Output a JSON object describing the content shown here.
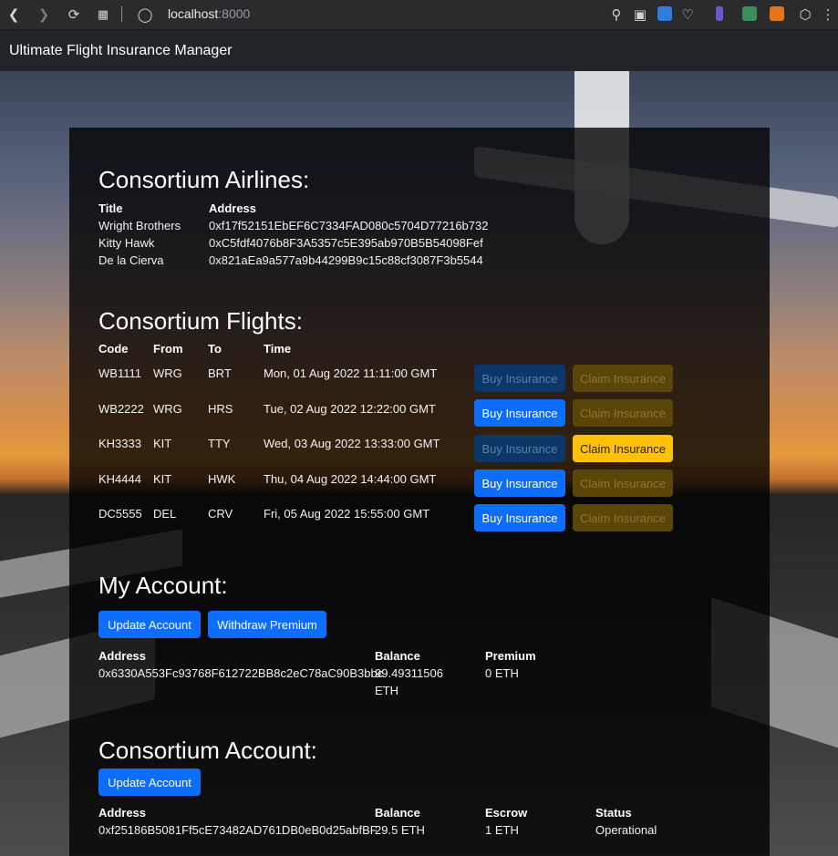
{
  "browser": {
    "url_host": "localhost",
    "url_port": ":8000"
  },
  "navbar": {
    "brand": "Ultimate Flight Insurance Manager"
  },
  "airlines": {
    "heading": "Consortium Airlines:",
    "headers": {
      "title": "Title",
      "address": "Address"
    },
    "rows": [
      {
        "title": "Wright Brothers",
        "address": "0xf17f52151EbEF6C7334FAD080c5704D77216b732"
      },
      {
        "title": "Kitty Hawk",
        "address": "0xC5fdf4076b8F3A5357c5E395ab970B5B54098Fef"
      },
      {
        "title": "De la Cierva",
        "address": "0x821aEa9a577a9b44299B9c15c88cf3087F3b5544"
      }
    ]
  },
  "flights": {
    "heading": "Consortium Flights:",
    "headers": {
      "code": "Code",
      "from": "From",
      "to": "To",
      "time": "Time"
    },
    "buy_label": "Buy Insurance",
    "claim_label": "Claim Insurance",
    "rows": [
      {
        "code": "WB1111",
        "from": "WRG",
        "to": "BRT",
        "time": "Mon, 01 Aug 2022 11:11:00 GMT",
        "buy_enabled": false,
        "claim_enabled": false
      },
      {
        "code": "WB2222",
        "from": "WRG",
        "to": "HRS",
        "time": "Tue, 02 Aug 2022 12:22:00 GMT",
        "buy_enabled": true,
        "claim_enabled": false
      },
      {
        "code": "KH3333",
        "from": "KIT",
        "to": "TTY",
        "time": "Wed, 03 Aug 2022 13:33:00 GMT",
        "buy_enabled": false,
        "claim_enabled": true
      },
      {
        "code": "KH4444",
        "from": "KIT",
        "to": "HWK",
        "time": "Thu, 04 Aug 2022 14:44:00 GMT",
        "buy_enabled": true,
        "claim_enabled": false
      },
      {
        "code": "DC5555",
        "from": "DEL",
        "to": "CRV",
        "time": "Fri, 05 Aug 2022 15:55:00 GMT",
        "buy_enabled": true,
        "claim_enabled": false
      }
    ]
  },
  "my_account": {
    "heading": "My Account:",
    "update_label": "Update Account",
    "withdraw_label": "Withdraw Premium",
    "headers": {
      "address": "Address",
      "balance": "Balance",
      "premium": "Premium"
    },
    "address": "0x6330A553Fc93768F612722BB8c2eC78aC90B3bbc",
    "balance_line1": "99.49311506",
    "balance_line2": "ETH",
    "premium": "0 ETH"
  },
  "consortium_account": {
    "heading": "Consortium Account:",
    "update_label": "Update Account",
    "headers": {
      "address": "Address",
      "balance": "Balance",
      "escrow": "Escrow",
      "status": "Status"
    },
    "address": "0xf25186B5081Ff5cE73482AD761DB0eB0d25abfBF",
    "balance": "29.5 ETH",
    "escrow": "1 ETH",
    "status": "Operational"
  },
  "colors": {
    "primary": "#0d6efd",
    "warning": "#ffc107",
    "navbar": "#212529"
  }
}
